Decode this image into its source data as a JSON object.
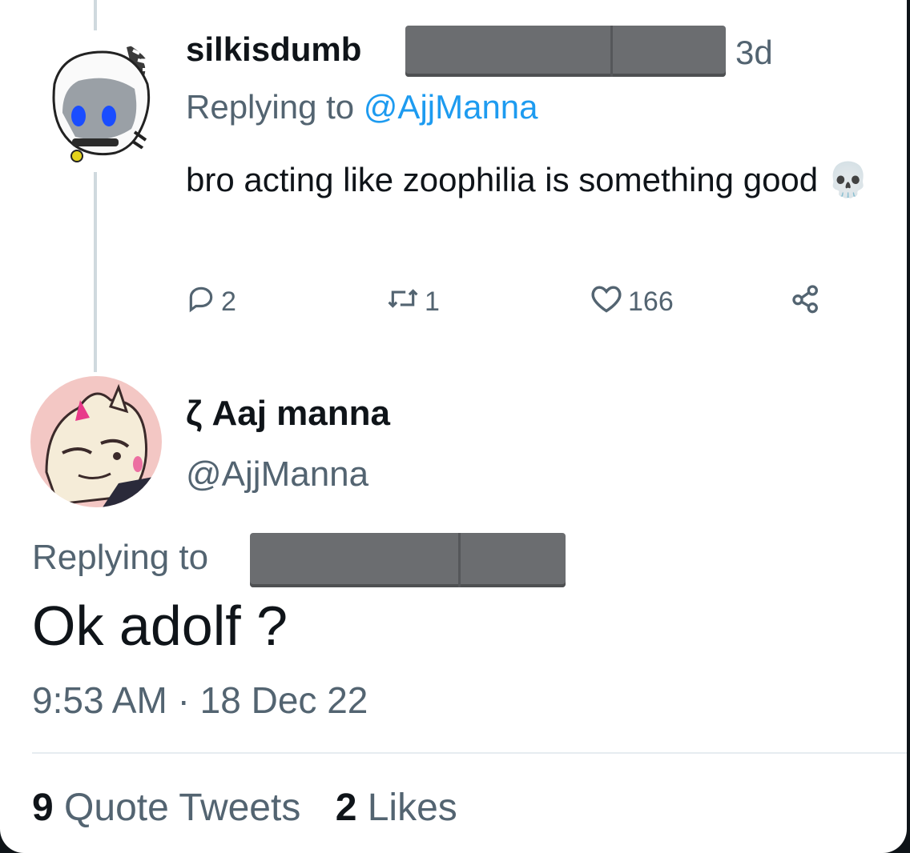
{
  "parent_tweet": {
    "display_name": "silkisdumb",
    "timestamp": "3d",
    "replying_prefix": "Replying to",
    "replying_handle": "@AjjManna",
    "text": "bro acting like zoophilia is something good",
    "emoji": "💀",
    "replies": "2",
    "retweets": "1",
    "likes": "166"
  },
  "main_tweet": {
    "display_name": "ζ Aaj manna",
    "handle": "@AjjManna",
    "replying_prefix": "Replying to",
    "text": "Ok adolf ?",
    "time": "9:53 AM",
    "separator": "·",
    "date": "18 Dec 22"
  },
  "stats": {
    "quote_count": "9",
    "quote_label": "Quote Tweets",
    "likes_count": "2",
    "likes_label": "Likes"
  },
  "colors": {
    "primary_text": "#0f1419",
    "secondary_text": "#536471",
    "mention": "#1d9bf0",
    "redaction": "#6b6d70"
  }
}
